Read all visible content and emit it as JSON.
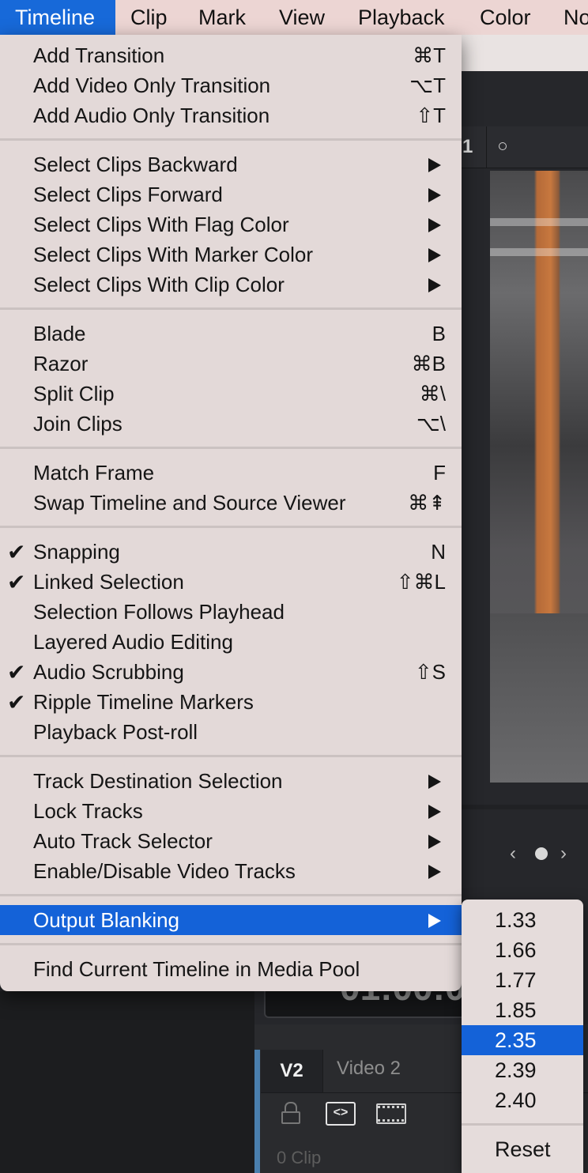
{
  "menubar": {
    "items": [
      "Timeline",
      "Clip",
      "Mark",
      "View",
      "Playback",
      "Color",
      "No"
    ],
    "active_index": 0
  },
  "menu": {
    "groups": [
      [
        {
          "label": "Add Transition",
          "shortcut": "⌘T"
        },
        {
          "label": "Add Video Only Transition",
          "shortcut": "⌥T"
        },
        {
          "label": "Add Audio Only Transition",
          "shortcut": "⇧T"
        }
      ],
      [
        {
          "label": "Select Clips Backward",
          "submenu": true
        },
        {
          "label": "Select Clips Forward",
          "submenu": true
        },
        {
          "label": "Select Clips With Flag Color",
          "submenu": true
        },
        {
          "label": "Select Clips With Marker Color",
          "submenu": true
        },
        {
          "label": "Select Clips With Clip Color",
          "submenu": true
        }
      ],
      [
        {
          "label": "Blade",
          "shortcut": "B"
        },
        {
          "label": "Razor",
          "shortcut": "⌘B"
        },
        {
          "label": "Split Clip",
          "shortcut": "⌘\\"
        },
        {
          "label": "Join Clips",
          "shortcut": "⌥\\"
        }
      ],
      [
        {
          "label": "Match Frame",
          "shortcut": "F"
        },
        {
          "label": "Swap Timeline and Source Viewer",
          "shortcut": "⌘⇞"
        }
      ],
      [
        {
          "label": "Snapping",
          "shortcut": "N",
          "checked": true
        },
        {
          "label": "Linked Selection",
          "shortcut": "⇧⌘L",
          "checked": true
        },
        {
          "label": "Selection Follows Playhead"
        },
        {
          "label": "Layered Audio Editing"
        },
        {
          "label": "Audio Scrubbing",
          "shortcut": "⇧S",
          "checked": true
        },
        {
          "label": "Ripple Timeline Markers",
          "checked": true
        },
        {
          "label": "Playback Post-roll"
        }
      ],
      [
        {
          "label": "Track Destination Selection",
          "submenu": true
        },
        {
          "label": "Lock Tracks",
          "submenu": true
        },
        {
          "label": "Auto Track Selector",
          "submenu": true
        },
        {
          "label": "Enable/Disable Video Tracks",
          "submenu": true
        }
      ],
      [
        {
          "label": "Output Blanking",
          "submenu": true,
          "highlighted": true
        }
      ],
      [
        {
          "label": "Find Current Timeline in Media Pool"
        }
      ]
    ]
  },
  "submenu": {
    "items": [
      "1.33",
      "1.66",
      "1.77",
      "1.85",
      "2.35",
      "2.39",
      "2.40"
    ],
    "selected": "2.35",
    "reset_label": "Reset"
  },
  "background": {
    "viewer_number": "1",
    "timecode": "01:00:09",
    "track_id": "V2",
    "track_name": "Video 2",
    "clip_count": "0 Clip"
  },
  "colors": {
    "accent": "#1462d8",
    "menubar_bg": "#ecd5d3",
    "menu_bg": "#e3d9d8"
  }
}
